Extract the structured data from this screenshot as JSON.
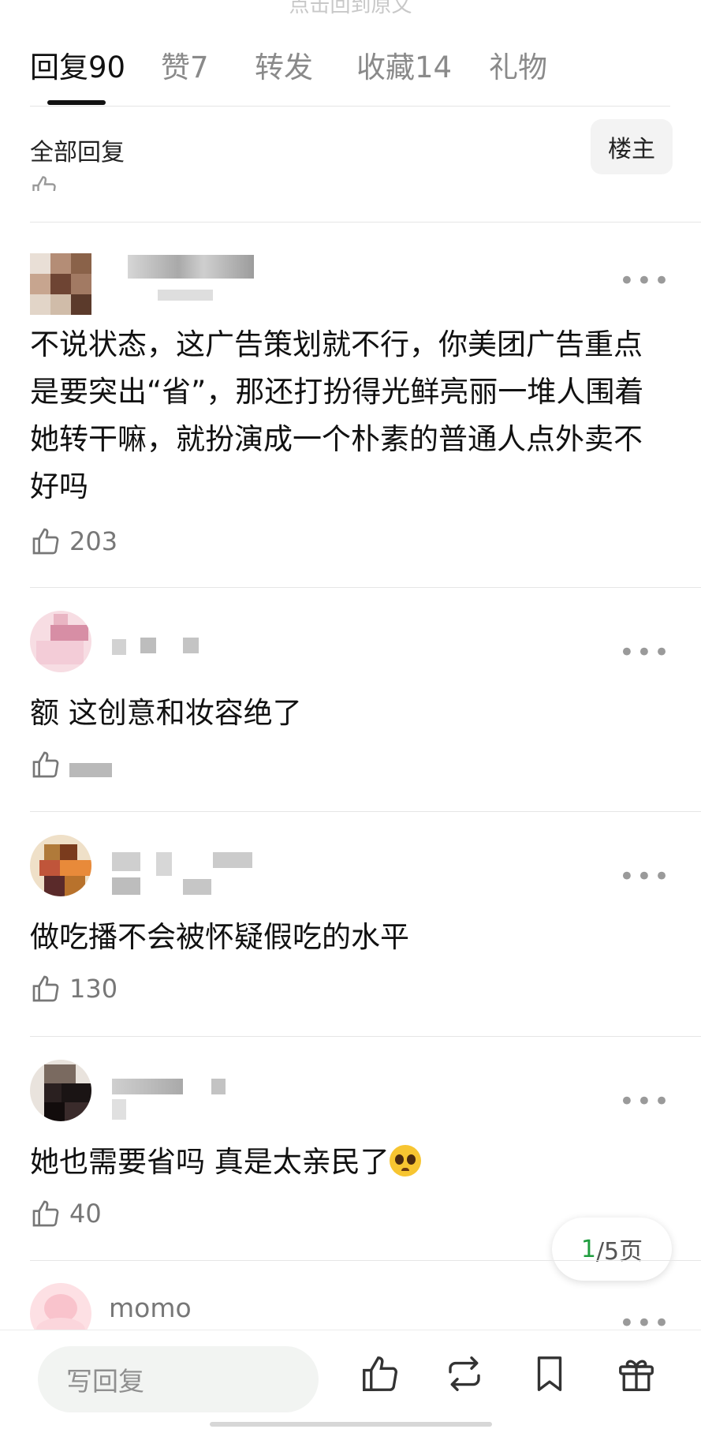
{
  "top_hint": "点击回到原文",
  "tabs": [
    {
      "label": "回复90"
    },
    {
      "label": "赞7"
    },
    {
      "label": "转发"
    },
    {
      "label": "收藏14"
    },
    {
      "label": "礼物"
    }
  ],
  "filter": {
    "title": "全部回复",
    "owner_button": "楼主"
  },
  "comments": [
    {
      "text": "不说状态，这广告策划就不行，你美团广告重点是要突出“省”，那还打扮得光鲜亮丽一堆人围着她转干嘛，就扮演成一个朴素的普通人点外卖不好吗",
      "likes": "203"
    },
    {
      "text": "额 这创意和妆容绝了",
      "likes": ""
    },
    {
      "text": "做吃播不会被怀疑假吃的水平",
      "likes": "130"
    },
    {
      "text": "她也需要省吗 真是太亲民了",
      "likes": "40"
    },
    {
      "name": "momo"
    }
  ],
  "more_label": "•••",
  "pagination": {
    "current": "1",
    "rest": "/5页"
  },
  "bottom_bar": {
    "reply_placeholder": "写回复"
  },
  "icons": {
    "like": "thumbs-up-icon",
    "repost": "repost-icon",
    "bookmark": "bookmark-icon",
    "gift": "gift-icon",
    "more": "more-dots-icon",
    "emoji": "pleading-face-emoji"
  },
  "colors": {
    "active_tab": "#111111",
    "page_current": "#1f9d3e",
    "muted": "#8a8a8a"
  }
}
